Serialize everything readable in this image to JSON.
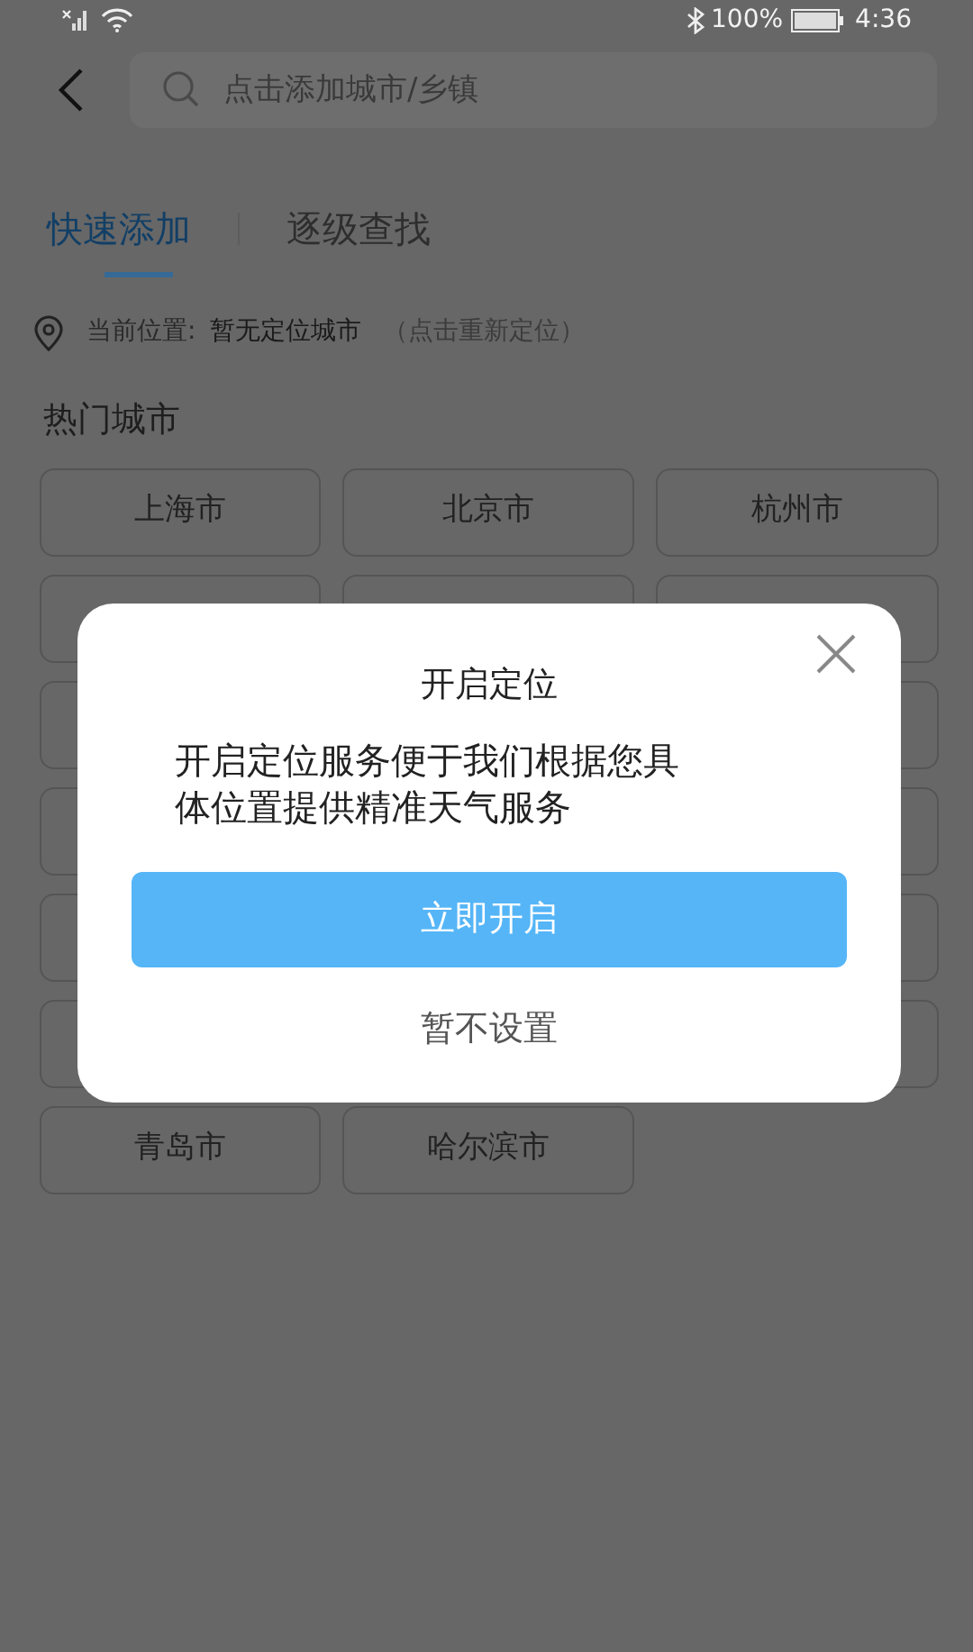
{
  "status_bar": {
    "battery": "100%",
    "time": "4:36"
  },
  "search": {
    "placeholder": "点击添加城市/乡镇"
  },
  "tabs": [
    {
      "label": "快速添加",
      "selected": true
    },
    {
      "label": "逐级查找",
      "selected": false
    }
  ],
  "location": {
    "label": "当前位置:",
    "value": "暂无定位城市",
    "action": "（点击重新定位）"
  },
  "hot_cities": {
    "title": "热门城市",
    "cities": [
      {
        "kind": "named",
        "name": "上海市"
      },
      {
        "kind": "named",
        "name": "北京市"
      },
      {
        "kind": "named",
        "name": "杭州市"
      },
      {
        "kind": "covered"
      },
      {
        "kind": "covered"
      },
      {
        "kind": "covered"
      },
      {
        "kind": "covered"
      },
      {
        "kind": "hidden"
      },
      {
        "kind": "covered"
      },
      {
        "kind": "covered"
      },
      {
        "kind": "hidden"
      },
      {
        "kind": "covered"
      },
      {
        "kind": "covered"
      },
      {
        "kind": "hidden"
      },
      {
        "kind": "covered"
      },
      {
        "kind": "covered"
      },
      {
        "kind": "hidden"
      },
      {
        "kind": "covered"
      },
      {
        "kind": "named",
        "name": "青岛市"
      },
      {
        "kind": "named",
        "name": "哈尔滨市"
      }
    ]
  },
  "dialog": {
    "title": "开启定位",
    "message": "开启定位服务便于我们根据您具体位置提供精准天气服务",
    "confirm": "立即开启",
    "cancel": "暂不设置"
  }
}
